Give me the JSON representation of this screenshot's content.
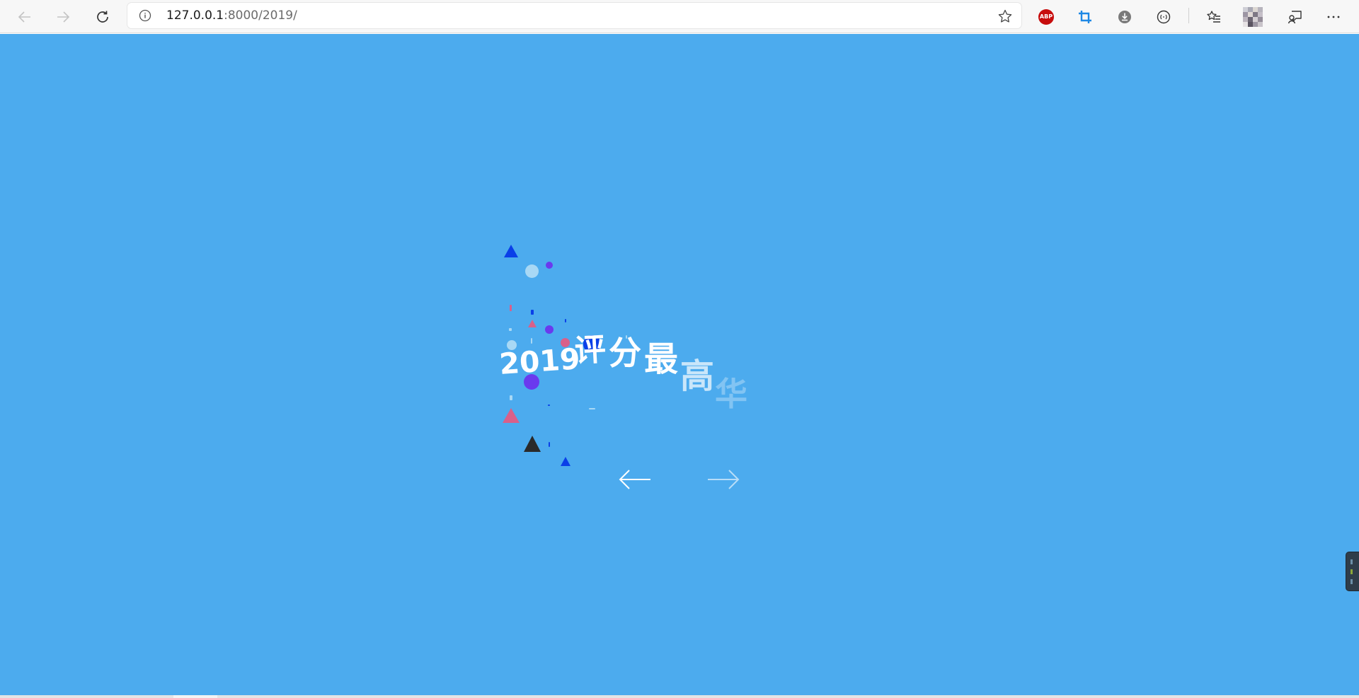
{
  "browser": {
    "url_host": "127.0.0.1",
    "url_rest": ":8000/2019/",
    "back_icon": "arrow-left-icon",
    "forward_icon": "arrow-right-icon",
    "reload_icon": "refresh-icon",
    "site_info_icon": "info-icon",
    "favorite_icon": "star-icon",
    "extensions": {
      "adblock_label": "ABP",
      "adblock_icon": "adblock-plus-icon",
      "screenshot_icon": "crop-icon",
      "download_icon": "download-circle-icon",
      "reader_icon": "ellipsis-circle-icon"
    },
    "favorites_icon": "favorites-list-icon",
    "profile_icon": "profile-avatar",
    "feedback_icon": "feedback-icon",
    "menu_icon": "more-horizontal-icon"
  },
  "slide": {
    "title_chars": [
      "2019",
      "评",
      "分",
      "最",
      "高",
      "华"
    ],
    "prev_icon": "arrow-left-icon",
    "next_icon": "arrow-right-icon"
  },
  "colors": {
    "page_background": "#4cabee",
    "toolbar_background": "#f7f7f7",
    "title_text": "#ffffff",
    "confetti_blue": "#0a3fe8",
    "confetti_purple": "#6a3aee",
    "confetti_pink": "#d9608a",
    "confetti_light": "#a8d8f5",
    "confetti_dark": "#2a2a2a"
  }
}
